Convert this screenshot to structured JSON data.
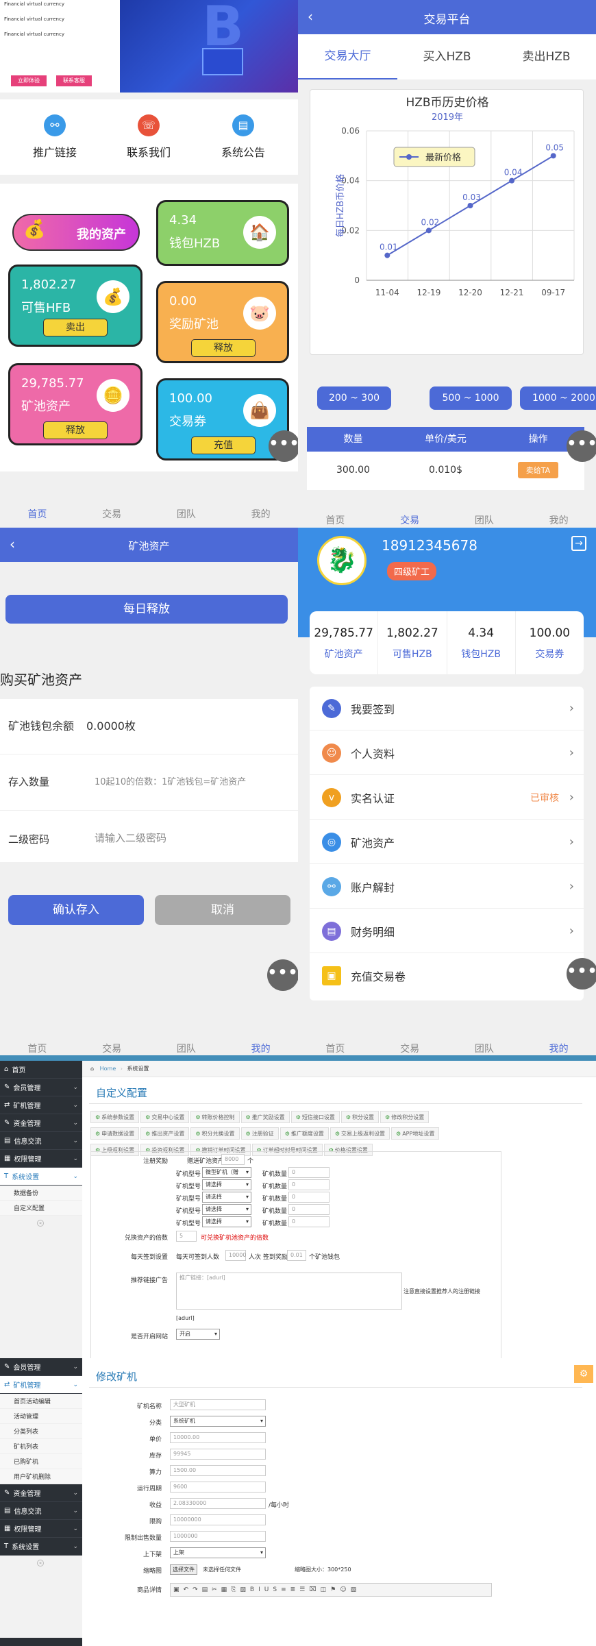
{
  "home": {
    "banner_lines": [
      "Financial virtual currency",
      "Financial virtual currency",
      "Financial virtual currency"
    ],
    "banner_btn1": "立即体验",
    "banner_btn2": "联系客服",
    "quick_links": [
      {
        "label": "推广链接",
        "icon": "link-icon"
      },
      {
        "label": "联系我们",
        "icon": "headset-icon"
      },
      {
        "label": "系统公告",
        "icon": "notice-icon"
      }
    ],
    "my_assets_label": "我的资产",
    "cards": {
      "wallet_hzb": {
        "value": "4.34",
        "label": "钱包HZB"
      },
      "sell_hfb": {
        "value": "1,802.27",
        "label": "可售HFB",
        "btn": "卖出"
      },
      "reward_pool": {
        "value": "0.00",
        "label": "奖励矿池",
        "btn": "释放"
      },
      "pool_assets": {
        "value": "29,785.77",
        "label": "矿池资产",
        "btn": "释放"
      },
      "trade_coupon": {
        "value": "100.00",
        "label": "交易券",
        "btn": "充值"
      }
    }
  },
  "nav": {
    "items": [
      "首页",
      "交易",
      "团队",
      "我的"
    ]
  },
  "trade": {
    "title": "交易平台",
    "tabs": [
      "交易大厅",
      "买入HZB",
      "卖出HZB"
    ],
    "ranges": [
      "200 ~ 300",
      "500 ~ 1000",
      "1000 ~ 2000"
    ],
    "table_headers": [
      "数量",
      "单价/美元",
      "操作"
    ],
    "row": {
      "qty": "300.00",
      "price": "0.010$",
      "action": "卖给TA"
    }
  },
  "chart_data": {
    "type": "line",
    "title": "HZB币历史价格",
    "subtitle": "2019年",
    "ylabel": "每日HZB币价格",
    "legend": "最新价格",
    "categories": [
      "11-04",
      "12-19",
      "12-20",
      "12-21",
      "09-17"
    ],
    "values": [
      0.01,
      0.02,
      0.03,
      0.04,
      0.05
    ],
    "value_labels": [
      "0.01",
      "0.02",
      "0.03",
      "0.04",
      "0.05"
    ],
    "yticks": [
      "0",
      "0.02",
      "0.04",
      "0.06"
    ],
    "ylim": [
      0,
      0.06
    ],
    "color": "#5567c9"
  },
  "mining": {
    "title": "矿池资产",
    "daily_release": "每日释放",
    "section_title": "购买矿池资产",
    "balance_label": "矿池钱包余额",
    "balance_value": "0.0000枚",
    "qty_label": "存入数量",
    "qty_placeholder": "10起10的倍数：1矿池钱包=矿池资产",
    "pwd_label": "二级密码",
    "pwd_placeholder": "请输入二级密码",
    "confirm": "确认存入",
    "cancel": "取消"
  },
  "profile": {
    "phone": "18912345678",
    "level": "四级矿工",
    "stats": [
      {
        "value": "29,785.77",
        "label": "矿池资产"
      },
      {
        "value": "1,802.27",
        "label": "可售HZB"
      },
      {
        "value": "4.34",
        "label": "钱包HZB"
      },
      {
        "value": "100.00",
        "label": "交易券"
      }
    ],
    "menu": [
      {
        "label": "我要签到",
        "color": "#4c6ad7",
        "icon": "signin-icon"
      },
      {
        "label": "个人资料",
        "color": "#f08a4b",
        "icon": "user-icon"
      },
      {
        "label": "实名认证",
        "color": "#f0a020",
        "icon": "verify-icon",
        "status": "已审核"
      },
      {
        "label": "矿池资产",
        "color": "#3a8ee6",
        "icon": "pool-icon"
      },
      {
        "label": "账户解封",
        "color": "#5aa8e6",
        "icon": "unlock-icon"
      },
      {
        "label": "财务明细",
        "color": "#7e6fd9",
        "icon": "finance-icon"
      },
      {
        "label": "充值交易卷",
        "color": "#f5c018",
        "icon": "gift-icon"
      }
    ]
  },
  "admin1": {
    "sidebar": [
      {
        "label": "首页"
      },
      {
        "label": "会员管理"
      },
      {
        "label": "矿机管理"
      },
      {
        "label": "资金管理"
      },
      {
        "label": "信息交流"
      },
      {
        "label": "权限管理"
      },
      {
        "label": "系统设置"
      }
    ],
    "sub_items": [
      "数据备份",
      "自定义配置"
    ],
    "breadcrumb_home": "Home",
    "breadcrumb_cur": "系统设置",
    "title": "自定义配置",
    "tabs_row1": [
      "系统参数设置",
      "交易中心设置",
      "转账价格控制",
      "推广奖励设置",
      "短信接口设置",
      "积分设置",
      "修改积分设置"
    ],
    "tabs_row2": [
      "申请数据设置",
      "推出资产设置",
      "积分兑换设置",
      "注册验证",
      "推广额度设置",
      "交易上级返利设置",
      "APP地址设置"
    ],
    "tabs_row3": [
      "上级返利设置",
      "投资返利设置",
      "撤销订单时间设置",
      "订单超时封号时间设置",
      "价格设置设置"
    ],
    "reg_reward": "注册奖励",
    "reg_text": "赠送矿池资产",
    "reg_val": "8000",
    "reg_unit": "个",
    "machine_type": "矿机型号",
    "machine_count": "矿机数量",
    "first_sel": "微型矿机（赠",
    "sel_placeholder": "请选择",
    "count_val": "0",
    "exchange_label": "兑换资产的倍数",
    "exchange_val": "5",
    "exchange_warn": "可兑换矿机池资产的倍数",
    "signin_label": "每天签到设置",
    "signin_text1": "每天可签到人数",
    "signin_val1": "10000",
    "signin_text2": "人次  签到奖励",
    "signin_val2": "0.01",
    "signin_text3": "个矿池钱包",
    "ad_label": "推荐链接广告",
    "ad_placeholder": "推广链接：[adurl]",
    "ad_hint": "注意直接设置推荐人的注册链接",
    "ad_url": "[adurl]",
    "open_label": "是否开启网站",
    "open_val": "开启"
  },
  "admin2": {
    "sidebar": [
      {
        "label": "会员管理"
      },
      {
        "label": "矿机管理"
      }
    ],
    "sub_items": [
      "首页活动编辑",
      "活动管理",
      "分类列表",
      "矿机列表",
      "已购矿机",
      "用户矿机删除"
    ],
    "sidebar_bottom": [
      {
        "label": "资金管理"
      },
      {
        "label": "信息交流"
      },
      {
        "label": "权限管理"
      },
      {
        "label": "系统设置"
      }
    ],
    "title": "修改矿机",
    "fields": [
      {
        "label": "矿机名称",
        "value": "大型矿机",
        "type": "input"
      },
      {
        "label": "分类",
        "value": "系统矿机",
        "type": "select"
      },
      {
        "label": "单价",
        "value": "10000.00",
        "type": "input"
      },
      {
        "label": "库存",
        "value": "99945",
        "type": "input"
      },
      {
        "label": "算力",
        "value": "1500.00",
        "type": "input"
      },
      {
        "label": "运行周期",
        "value": "9600",
        "type": "input"
      },
      {
        "label": "收益",
        "value": "2.08330000",
        "type": "input",
        "suffix": "/每小时"
      },
      {
        "label": "限购",
        "value": "10000000",
        "type": "input"
      },
      {
        "label": "限制出售数量",
        "value": "1000000",
        "type": "input"
      },
      {
        "label": "上下架",
        "value": "上架",
        "type": "select"
      }
    ],
    "thumb_label": "缩略图",
    "choose_file": "选择文件",
    "no_file": "未选择任何文件",
    "thumb_size": "缩略图大小：300*250",
    "detail_label": "商品详情"
  }
}
